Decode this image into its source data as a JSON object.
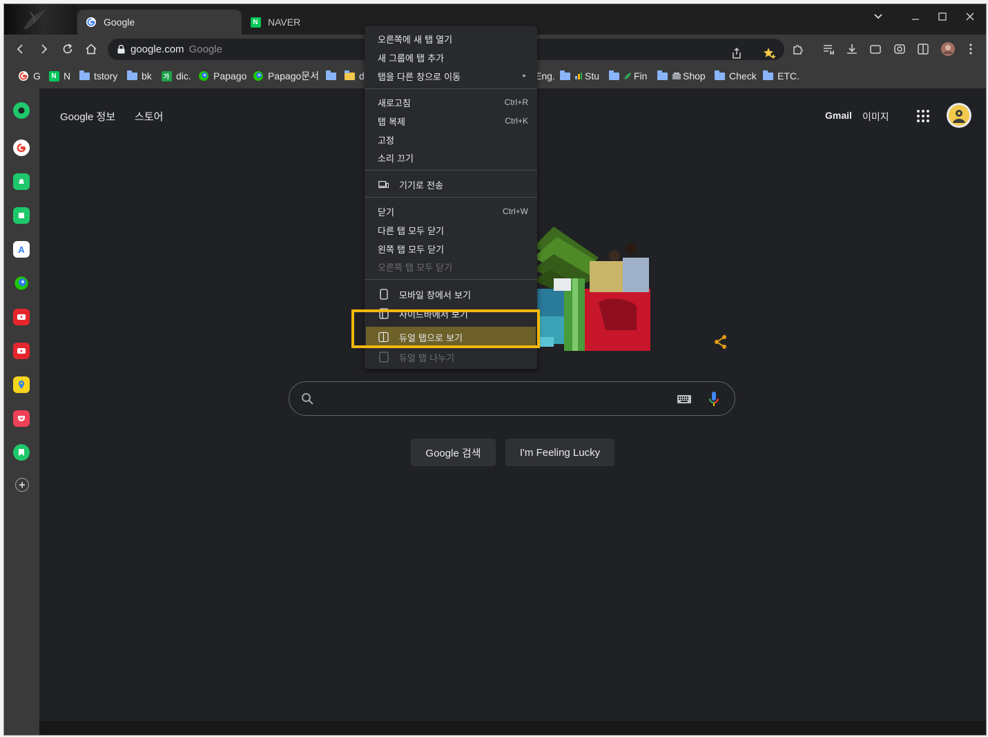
{
  "tabs": [
    {
      "title": "Google",
      "active": true
    },
    {
      "title": "NAVER",
      "active": false
    }
  ],
  "omnibox": {
    "url": "google.com",
    "site_name": "Google"
  },
  "bookmarks": [
    {
      "label": "G",
      "icon": "google-icon"
    },
    {
      "label": "N",
      "icon": "naver-icon"
    },
    {
      "label": "tstory",
      "icon": "folder-icon"
    },
    {
      "label": "bk",
      "icon": "folder-icon"
    },
    {
      "label": "dic.",
      "icon": "dictionary-icon"
    },
    {
      "label": "Papago",
      "icon": "papago-icon"
    },
    {
      "label": "Papago문서",
      "icon": "papago-icon"
    },
    {
      "label": "d",
      "icon": "folder-icon"
    },
    {
      "label": "Eng.",
      "icon": "folder-icon"
    },
    {
      "label": "Stu",
      "icon": "folder-icon"
    },
    {
      "label": "Fin",
      "icon": "folder-icon"
    },
    {
      "label": "Shop",
      "icon": "folder-icon"
    },
    {
      "label": "Check",
      "icon": "folder-icon"
    },
    {
      "label": "ETC.",
      "icon": "folder-icon"
    }
  ],
  "google": {
    "about": "Google 정보",
    "store": "스토어",
    "gmail": "Gmail",
    "images": "이미지",
    "search_button": "Google 검색",
    "lucky_button": "I'm Feeling Lucky",
    "search_placeholder": ""
  },
  "context_menu": {
    "open_new_tab_right": "오른쪽에 새 탭 열기",
    "add_to_new_group": "새 그룹에 탭 추가",
    "move_to_other_window": "탭을 다른 창으로 이동",
    "reload": "새로고침",
    "reload_shortcut": "Ctrl+R",
    "duplicate": "탭 복제",
    "duplicate_shortcut": "Ctrl+K",
    "pin": "고정",
    "mute": "소리 끄기",
    "send_to_device": "기기로 전송",
    "close": "닫기",
    "close_shortcut": "Ctrl+W",
    "close_other_tabs": "다른 탭 모두 닫기",
    "close_left_tabs": "왼쪽 탭 모두 닫기",
    "close_right_tabs": "오른쪽 탭 모두 닫기",
    "view_mobile": "모바일 창에서 보기",
    "view_sidebar": "사이드바에서 보기",
    "view_dual_tab": "듀얼 탭으로 보기",
    "split_dual_tab": "듀얼 탭 나누기"
  },
  "colors": {
    "highlight_outline": "#f1b70b",
    "highlight_fill": "#6d6028",
    "menu_bg": "#292a2d"
  }
}
